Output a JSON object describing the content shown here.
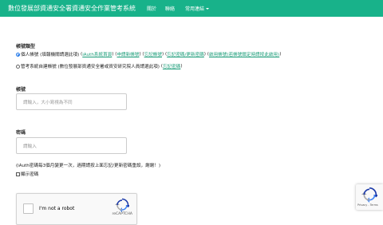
{
  "navbar": {
    "brand": "數位發展部資通安全署資通安全作業管考系統",
    "about": "關於",
    "contact": "聯絡",
    "links": "常用連結",
    "bg_color": "#18b28a"
  },
  "form": {
    "account_type_label": "帳號類型",
    "personal": {
      "text": "個人帳號 (填報機關請選此項)",
      "links": [
        "iAuth系統首頁",
        "申請新帳號",
        "忘記帳號",
        "忘記密碼/更新密碼",
        "啟用帳號(若帳號鎖定時請按此啟用)"
      ],
      "checked": true
    },
    "builtin": {
      "text": "管考系統自建帳號 (數位發展部資通安全署或資安研究院人員請選此項)",
      "link": "忘記密碼",
      "checked": false
    },
    "username_label": "帳號",
    "username_placeholder": "請輸入，大小寫視為不同",
    "password_label": "密碼",
    "password_placeholder": "請輸入",
    "note": "(iAuth密碼每3個月變更一次，過期請按上面忘記/更新密碼重設，謝謝！)",
    "show_password": "顯示密碼"
  },
  "captcha": {
    "text": "I'm not a robot",
    "brand": "reCAPTCHA"
  },
  "badge": {
    "privacy": "Privacy - Terms"
  }
}
